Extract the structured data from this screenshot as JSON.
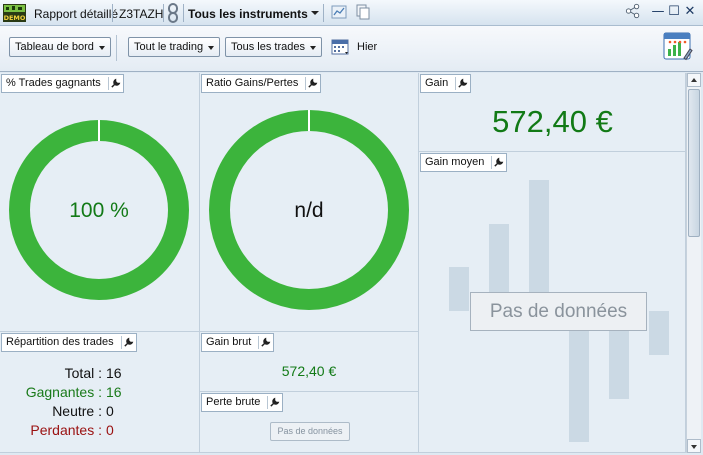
{
  "titlebar": {
    "demo_badge": "DEMO",
    "report_label": "Rapport détaillé",
    "account": "Z3TAZH",
    "instrument_filter": "Tous les instruments",
    "icons": [
      "demo-badge-icon",
      "link-icon",
      "chart-icon",
      "copy-icon",
      "share-icon"
    ]
  },
  "window_controls": {
    "minimize": "—",
    "maximize": "☐",
    "close": "✕"
  },
  "toolbar": {
    "dashboard": "Tableau de bord",
    "trading": "Tout le trading",
    "trades": "Tous les trades",
    "period": "Hier"
  },
  "panels": {
    "win_pct": {
      "title": "% Trades gagnants",
      "value": "100 %",
      "fraction": 1.0
    },
    "ratio": {
      "title": "Ratio Gains/Pertes",
      "value": "n/d",
      "fraction": 1.0
    },
    "gain": {
      "title": "Gain",
      "value": "572,40 €"
    },
    "avg_gain": {
      "title": "Gain moyen",
      "no_data": "Pas de données"
    },
    "distribution": {
      "title": "Répartition des trades",
      "rows": [
        {
          "label": "Total :",
          "value": "16",
          "color": "#111111"
        },
        {
          "label": "Gagnantes :",
          "value": "16",
          "color": "#1a7a1a"
        },
        {
          "label": "Neutre :",
          "value": "0",
          "color": "#111111"
        },
        {
          "label": "Perdantes :",
          "value": "0",
          "color": "#9a1010"
        }
      ]
    },
    "gross_gain": {
      "title": "Gain brut",
      "value": "572,40 €"
    },
    "gross_loss": {
      "title": "Perte brute",
      "no_data": "Pas de données"
    }
  },
  "colors": {
    "donut": "#3cb43c",
    "gain_text": "#127a16",
    "ghost_bar": "#cbd9e4"
  }
}
